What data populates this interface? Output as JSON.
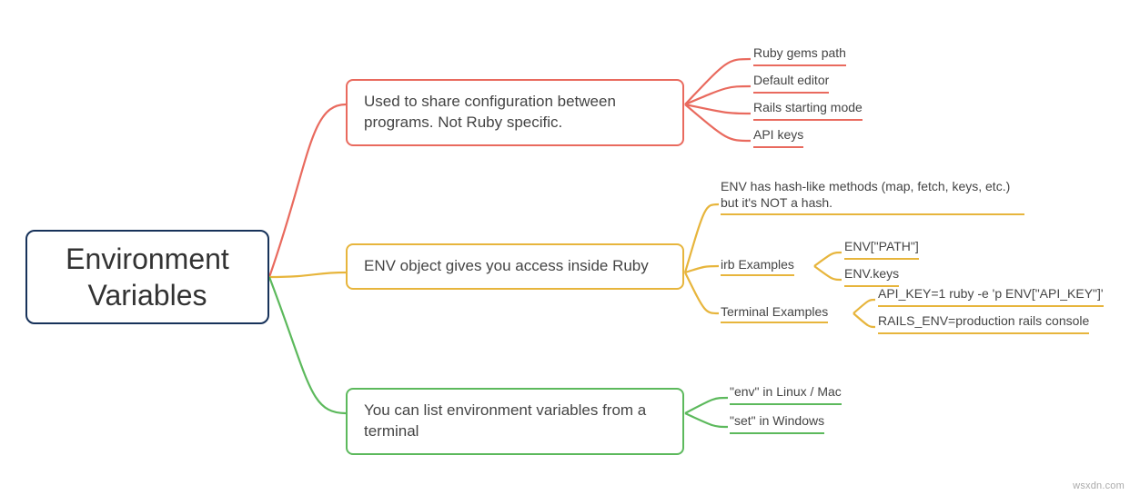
{
  "root": {
    "title": "Environment\nVariables"
  },
  "branches": [
    {
      "color": "red",
      "text": "Used to share configuration between programs. Not Ruby specific.",
      "leaves": [
        {
          "text": "Ruby gems path"
        },
        {
          "text": "Default editor"
        },
        {
          "text": "Rails starting mode"
        },
        {
          "text": "API keys"
        }
      ]
    },
    {
      "color": "yellow",
      "text": "ENV object gives you access inside Ruby",
      "leaves": [
        {
          "text": "ENV has hash-like methods (map, fetch, keys, etc.) but it's NOT a hash."
        },
        {
          "label": "irb Examples",
          "children": [
            {
              "text": "ENV[\"PATH\"]"
            },
            {
              "text": "ENV.keys"
            }
          ]
        },
        {
          "label": "Terminal Examples",
          "children": [
            {
              "text": "API_KEY=1 ruby -e 'p ENV[\"API_KEY\"]'"
            },
            {
              "text": "RAILS_ENV=production rails console"
            }
          ]
        }
      ]
    },
    {
      "color": "green",
      "text": "You can list environment variables from a terminal",
      "leaves": [
        {
          "text": "\"env\" in Linux / Mac"
        },
        {
          "text": "\"set\" in Windows"
        }
      ]
    }
  ],
  "watermark": "wsxdn.com",
  "colors": {
    "red": "#e96a5e",
    "yellow": "#e7b53c",
    "green": "#5cb95c",
    "root": "#17325a"
  }
}
